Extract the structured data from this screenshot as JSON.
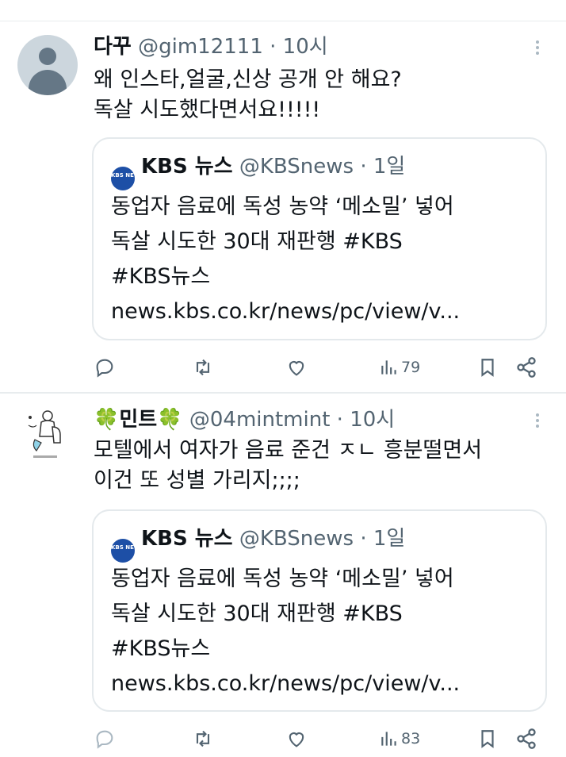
{
  "posts": [
    {
      "name": "다꾸",
      "handle": "@gim12111",
      "dot": "·",
      "time": "10시",
      "text_lines": [
        "왜 인스타,얼굴,신상 공개 안 해요?",
        "독살 시도했다면서요!!!!!"
      ],
      "quote": {
        "logo_text": "KBS NEWS",
        "name": "KBS 뉴스",
        "handle": "@KBSnews",
        "dot": "·",
        "time": "1일",
        "lines": [
          "동업자 음료에 독성 농약 ‘메소밀’ 넣어",
          "독살 시도한 30대 재판행 #KBS",
          "#KBS뉴스",
          "news.kbs.co.kr/news/pc/view/v..."
        ]
      },
      "views": "79"
    },
    {
      "name": "🍀민트🍀",
      "handle": "@04mintmint",
      "dot": "·",
      "time": "10시",
      "text_lines": [
        "모텔에서 여자가 음료 준건 ㅈㄴ 흥분떨면서",
        "이건 또 성별 가리지;;;;"
      ],
      "quote": {
        "logo_text": "KBS NEWS",
        "name": "KBS 뉴스",
        "handle": "@KBSnews",
        "dot": "·",
        "time": "1일",
        "lines": [
          "동업자 음료에 독성 농약 ‘메소밀’ 넣어",
          "독살 시도한 30대 재판행 #KBS",
          "#KBS뉴스",
          "news.kbs.co.kr/news/pc/view/v..."
        ]
      },
      "views": "83"
    }
  ],
  "icons": {
    "reply": "reply-icon",
    "retweet": "retweet-icon",
    "like": "heart-icon",
    "views": "views-icon",
    "bookmark": "bookmark-icon",
    "share": "share-icon"
  },
  "colors": {
    "icon": "#536471",
    "kbs_blue": "#1d4fa6",
    "border": "#e4e9ec"
  }
}
